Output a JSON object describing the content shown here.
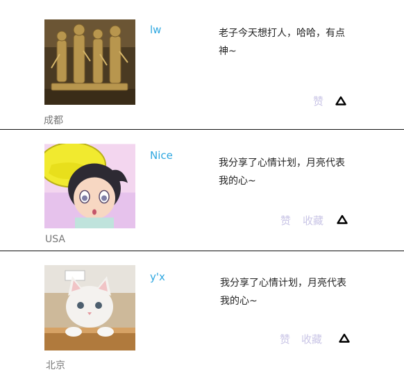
{
  "icons": {
    "avatar_1": "bronze-figures-photo",
    "avatar_2": "anime-girl-avatar",
    "avatar_3": "kitten-photo",
    "upvote": "triangle-up-icon"
  },
  "colors": {
    "username": "#2ea7e0",
    "action": "#c9c5e6",
    "location": "#777777",
    "divider": "#111111"
  },
  "posts": [
    {
      "username": "lw",
      "content": "老子今天想打人，哈哈，有点神~",
      "location": "成都",
      "actions": {
        "like": "赞"
      }
    },
    {
      "username": "Nice",
      "content": "我分享了心情计划，月亮代表我的心~",
      "location": "USA",
      "actions": {
        "like": "赞",
        "favorite": "收藏"
      }
    },
    {
      "username": "y'x",
      "content": "我分享了心情计划，月亮代表我的心~",
      "location": "北京",
      "actions": {
        "like": "赞",
        "favorite": "收藏"
      }
    }
  ]
}
